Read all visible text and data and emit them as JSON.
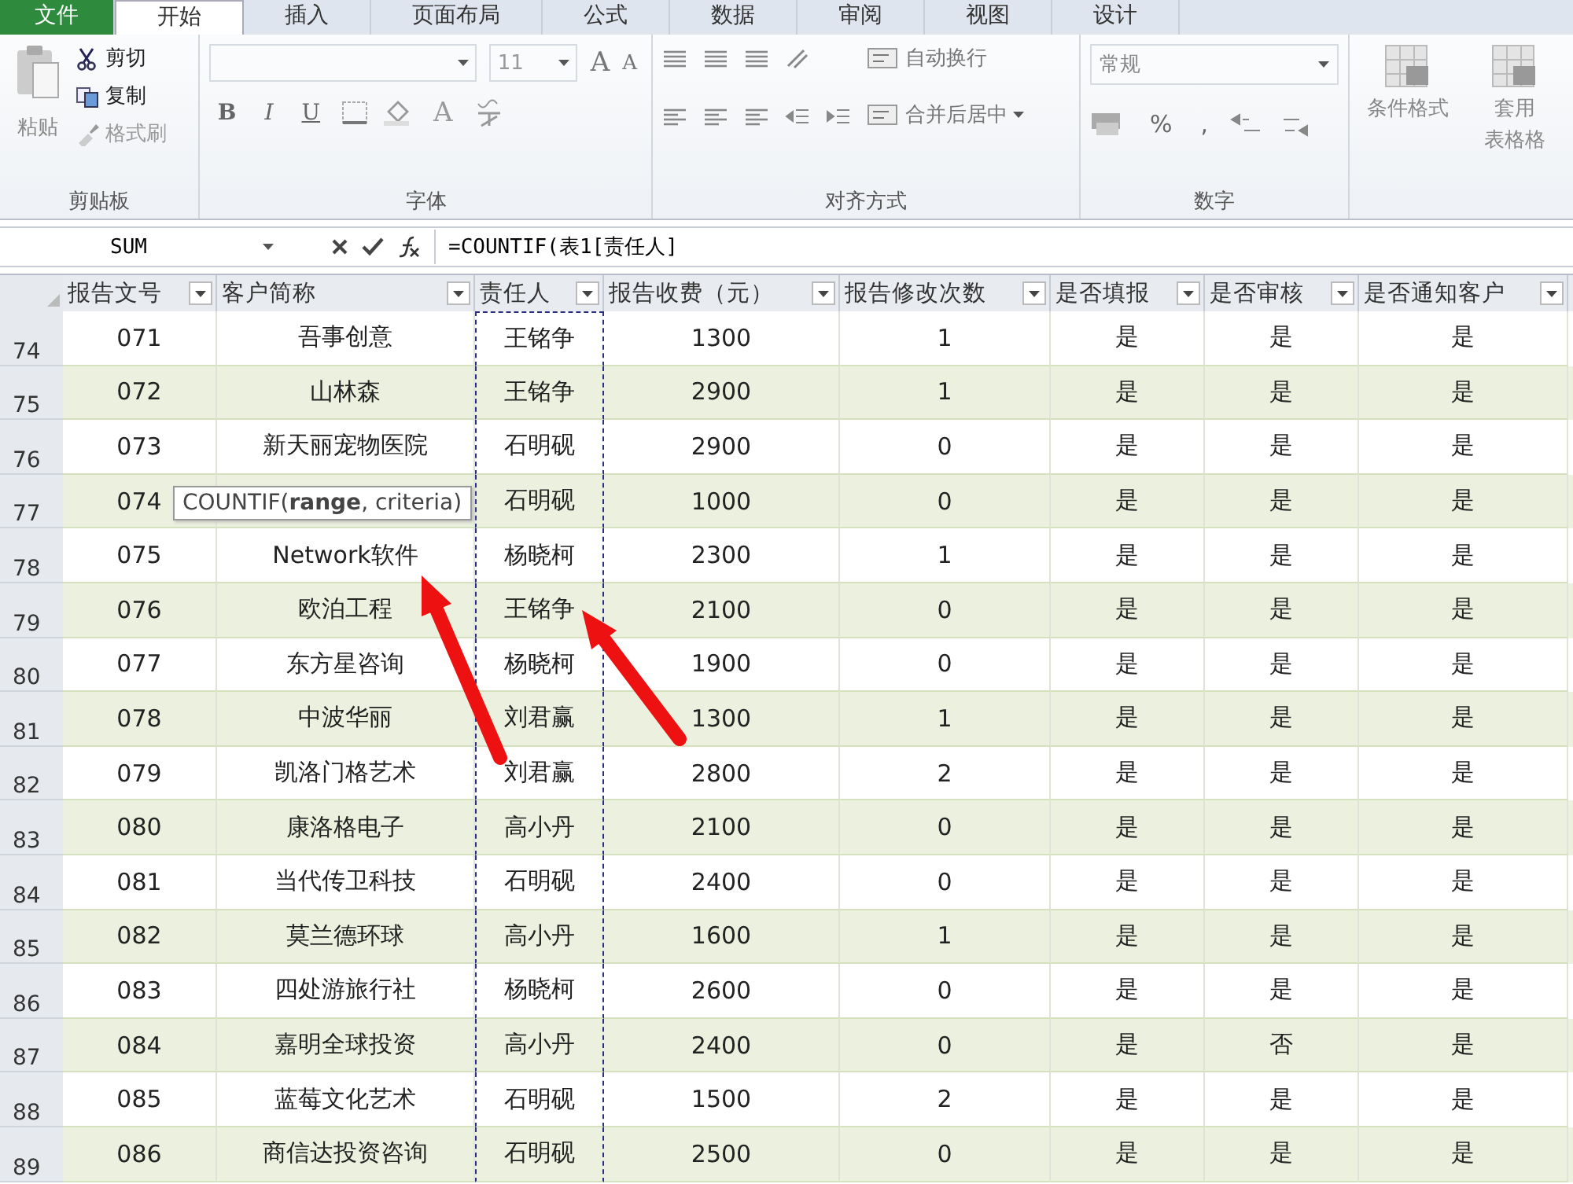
{
  "tabs": [
    {
      "label": "文件",
      "kind": "file",
      "selected": false
    },
    {
      "label": "开始",
      "kind": "tab",
      "selected": true
    },
    {
      "label": "插入",
      "kind": "tab",
      "selected": false
    },
    {
      "label": "页面布局",
      "kind": "tab",
      "selected": false
    },
    {
      "label": "公式",
      "kind": "tab",
      "selected": false
    },
    {
      "label": "数据",
      "kind": "tab",
      "selected": false
    },
    {
      "label": "审阅",
      "kind": "tab",
      "selected": false
    },
    {
      "label": "视图",
      "kind": "tab",
      "selected": false
    },
    {
      "label": "设计",
      "kind": "tab",
      "selected": false
    }
  ],
  "ribbon": {
    "groups": [
      {
        "kind": "clipboard",
        "label": "剪贴板",
        "paste": "粘贴",
        "items": [
          "剪切",
          "复制",
          "格式刷"
        ]
      },
      {
        "kind": "font",
        "label": "字体",
        "size": "11",
        "size_buttons": [
          "A",
          "A"
        ],
        "buttons": [
          "B",
          "I",
          "U"
        ],
        "color_button": "A"
      },
      {
        "kind": "align",
        "label": "对齐方式",
        "items": [
          "自动换行",
          "合并后居中"
        ]
      },
      {
        "kind": "number",
        "label": "数字",
        "format": "常规",
        "buttons": [
          "%",
          ","
        ]
      },
      {
        "kind": "styles",
        "items": [
          {
            "lines": [
              "条件格式"
            ]
          },
          {
            "lines": [
              "套用",
              "表格格"
            ]
          }
        ]
      }
    ]
  },
  "formula_bar": {
    "name_box": "SUM",
    "formula": "=COUNTIF(表1[责任人]"
  },
  "table": {
    "columns": [
      {
        "label": "报告文号",
        "referenced": false
      },
      {
        "label": "客户简称",
        "referenced": false
      },
      {
        "label": "责任人",
        "referenced": true
      },
      {
        "label": "报告收费（元）",
        "referenced": false
      },
      {
        "label": "报告修改次数",
        "referenced": false
      },
      {
        "label": "是否填报",
        "referenced": false
      },
      {
        "label": "是否审核",
        "referenced": false
      },
      {
        "label": "是否通知客户",
        "referenced": false
      }
    ],
    "rows": [
      {
        "row": "74",
        "cells": [
          "071",
          "吾事创意",
          "王铭争",
          "1300",
          "1",
          "是",
          "是",
          "是"
        ]
      },
      {
        "row": "75",
        "cells": [
          "072",
          "山林森",
          "王铭争",
          "2900",
          "1",
          "是",
          "是",
          "是"
        ]
      },
      {
        "row": "76",
        "cells": [
          "073",
          "新天丽宠物医院",
          "石明砚",
          "2900",
          "0",
          "是",
          "是",
          "是"
        ]
      },
      {
        "row": "77",
        "cells": [
          "074",
          null,
          "石明砚",
          "1000",
          "0",
          "是",
          "是",
          "是"
        ]
      },
      {
        "row": "78",
        "cells": [
          "075",
          "Network软件",
          "杨晓柯",
          "2300",
          "1",
          "是",
          "是",
          "是"
        ]
      },
      {
        "row": "79",
        "cells": [
          "076",
          "欧泊工程",
          "王铭争",
          "2100",
          "0",
          "是",
          "是",
          "是"
        ]
      },
      {
        "row": "80",
        "cells": [
          "077",
          "东方星咨询",
          "杨晓柯",
          "1900",
          "0",
          "是",
          "是",
          "是"
        ]
      },
      {
        "row": "81",
        "cells": [
          "078",
          "中波华丽",
          "刘君赢",
          "1300",
          "1",
          "是",
          "是",
          "是"
        ]
      },
      {
        "row": "82",
        "cells": [
          "079",
          "凯洛门格艺术",
          "刘君赢",
          "2800",
          "2",
          "是",
          "是",
          "是"
        ]
      },
      {
        "row": "83",
        "cells": [
          "080",
          "康洛格电子",
          "高小丹",
          "2100",
          "0",
          "是",
          "是",
          "是"
        ]
      },
      {
        "row": "84",
        "cells": [
          "081",
          "当代传卫科技",
          "石明砚",
          "2400",
          "0",
          "是",
          "是",
          "是"
        ]
      },
      {
        "row": "85",
        "cells": [
          "082",
          "莫兰德环球",
          "高小丹",
          "1600",
          "1",
          "是",
          "是",
          "是"
        ]
      },
      {
        "row": "86",
        "cells": [
          "083",
          "四处游旅行社",
          "杨晓柯",
          "2600",
          "0",
          "是",
          "是",
          "是"
        ]
      },
      {
        "row": "87",
        "cells": [
          "084",
          "嘉明全球投资",
          "高小丹",
          "2400",
          "0",
          "是",
          "否",
          "是"
        ]
      },
      {
        "row": "88",
        "cells": [
          "085",
          "蓝莓文化艺术",
          "石明砚",
          "1500",
          "2",
          "是",
          "是",
          "是"
        ]
      },
      {
        "row": "89",
        "cells": [
          "086",
          "商信达投资咨询",
          "石明砚",
          "2500",
          "0",
          "是",
          "是",
          "是"
        ]
      }
    ]
  },
  "tooltip": "COUNTIF(**range**, criteria)"
}
